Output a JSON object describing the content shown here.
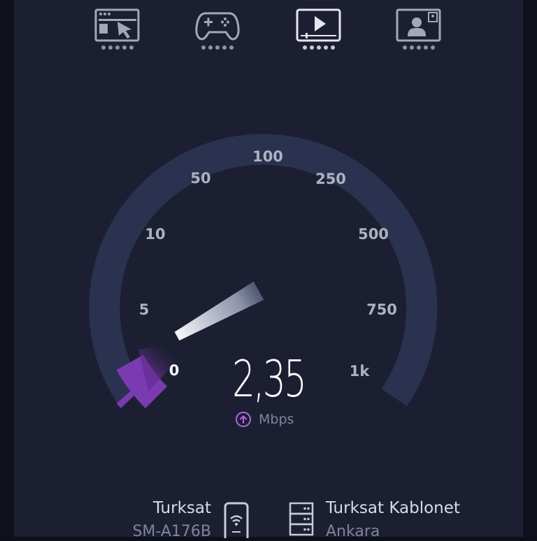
{
  "test_types": [
    {
      "name": "browsing",
      "icon": "browser-cursor-icon",
      "active": false
    },
    {
      "name": "gaming",
      "icon": "gamepad-icon",
      "active": false
    },
    {
      "name": "video",
      "icon": "video-play-icon",
      "active": true
    },
    {
      "name": "video-call",
      "icon": "video-call-icon",
      "active": false
    }
  ],
  "gauge": {
    "scale_labels": [
      "0",
      "5",
      "10",
      "50",
      "100",
      "250",
      "500",
      "750",
      "1k"
    ],
    "current_value": 2.35,
    "colors": {
      "track": "#2a3250",
      "fill": "#7b3bb0",
      "needle": "#e8e9ef",
      "accent": "#b366e0"
    }
  },
  "readout": {
    "value": "2,35",
    "unit": "Mbps",
    "direction_icon": "upload-arrow-icon"
  },
  "provider": {
    "name": "Turksat",
    "device": "SM-A176B",
    "icon": "phone-wifi-icon"
  },
  "server": {
    "name": "Turksat Kablonet",
    "location": "Ankara",
    "icon": "server-icon"
  }
}
